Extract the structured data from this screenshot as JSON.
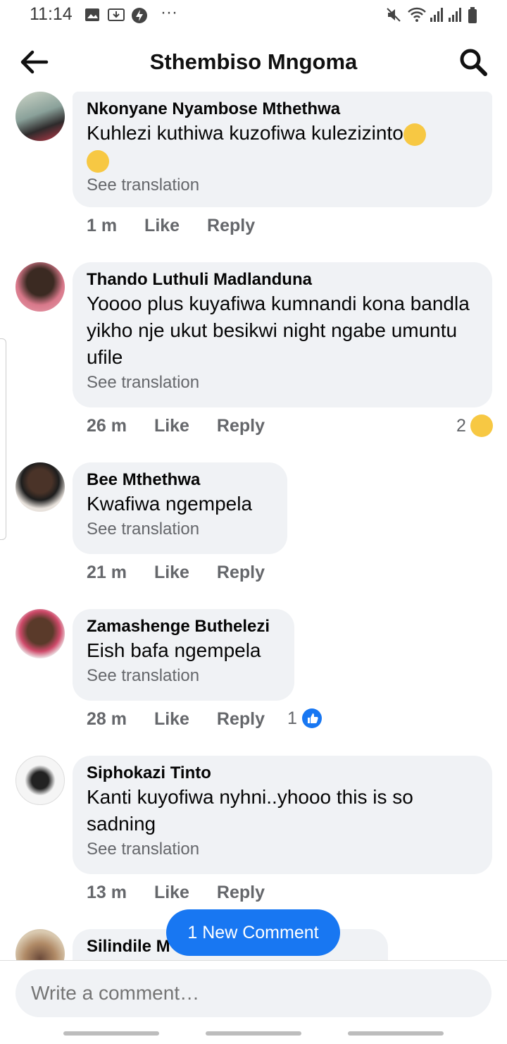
{
  "status_bar": {
    "time": "11:14",
    "dots": "···"
  },
  "header": {
    "title": "Sthembiso Mngoma"
  },
  "comments": [
    {
      "author": "Nkonyane Nyambose Mthethwa",
      "text": "Kuhlezi kuthiwa kuzofiwa kulezizinto",
      "translate": "See translation",
      "time": "1 m",
      "like": "Like",
      "reply": "Reply"
    },
    {
      "author": "Thando Luthuli Madlanduna",
      "text": "Yoooo plus kuyafiwa kumnandi kona bandla yikho nje ukut besikwi night ngabe umuntu ufile",
      "translate": "See translation",
      "time": "26 m",
      "like": "Like",
      "reply": "Reply",
      "reaction_count": "2"
    },
    {
      "author": "Bee Mthethwa",
      "text": "Kwafiwa ngempela",
      "translate": "See translation",
      "time": "21 m",
      "like": "Like",
      "reply": "Reply"
    },
    {
      "author": "Zamashenge Buthelezi",
      "text": "Eish bafa ngempela",
      "translate": "See translation",
      "time": "28 m",
      "like": "Like",
      "reply": "Reply",
      "reaction_count": "1"
    },
    {
      "author": "Siphokazi Tinto",
      "text": "Kanti kuyofiwa nyhni..yhooo this is so sadning",
      "translate": "See translation",
      "time": "13 m",
      "like": "Like",
      "reply": "Reply"
    },
    {
      "author": "Silindile M"
    }
  ],
  "new_comment_label": "1 New Comment",
  "composer": {
    "placeholder": "Write a comment…"
  },
  "colors": {
    "accent": "#1877f2",
    "bubble": "#f0f2f5",
    "meta": "#65676b"
  }
}
